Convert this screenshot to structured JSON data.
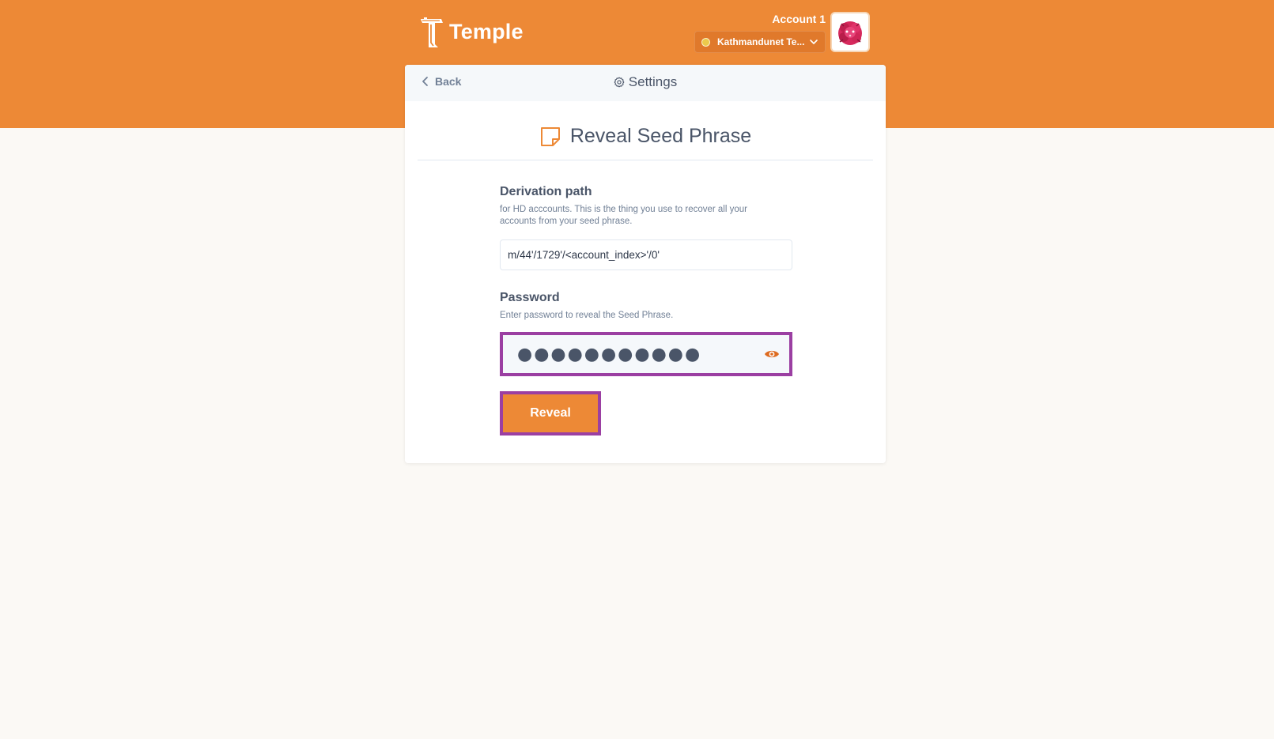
{
  "header": {
    "brand": "Temple",
    "account_name": "Account 1",
    "network": {
      "label": "Kathmandunet Te...",
      "status_color": "#ecc94b"
    },
    "avatar_icon": "identicon"
  },
  "nav": {
    "back_label": "Back",
    "page_title": "Settings",
    "page_title_icon": "gear-icon"
  },
  "section": {
    "heading": "Reveal Seed Phrase",
    "heading_icon": "sticky-note-icon"
  },
  "derivation": {
    "label": "Derivation path",
    "description": "for HD acccounts. This is the thing you use to recover all your accounts from your seed phrase.",
    "value": "m/44'/1729'/<account_index>'/0'"
  },
  "password": {
    "label": "Password",
    "description": "Enter password to reveal the Seed Phrase.",
    "value": "●●●●●●●●●●●",
    "toggle_icon": "eye-icon"
  },
  "actions": {
    "reveal_label": "Reveal"
  },
  "colors": {
    "accent": "#ed8936",
    "highlight": "#9b3fa2",
    "background": "#fbf9f5"
  }
}
